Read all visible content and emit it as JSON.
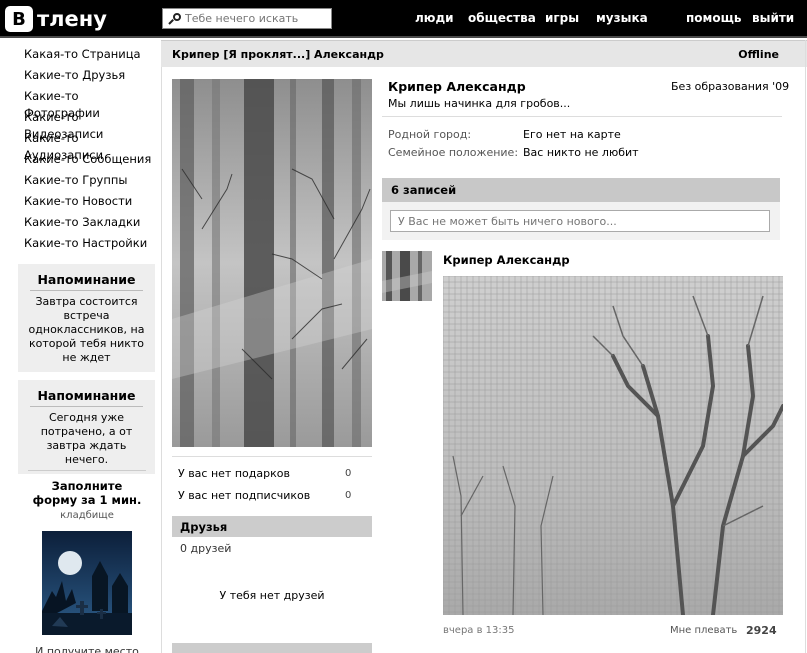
{
  "header": {
    "logo_letter": "В",
    "logo_text": "тлену",
    "search_placeholder": "Тебе нечего искать",
    "nav": [
      "люди",
      "общества",
      "игры",
      "музыка",
      "помощь",
      "выйти"
    ]
  },
  "sidebar": {
    "items": [
      "Какая-то Страница",
      "Какие-то Друзья",
      "Какие-то Фотографии",
      "Какие-то Видеозаписи",
      "Какие-то Аудиозаписи",
      "Какие-то Сообщения",
      "Какие-то Группы",
      "Какие-то Новости",
      "Какие-то Закладки",
      "Какие-то Настройки"
    ],
    "reminders": [
      {
        "title": "Напоминание",
        "text": "Завтра состоится встреча одноклассников, на которой тебя никто не ждет"
      },
      {
        "title": "Напоминание",
        "text": "Сегодня уже потрачено, а от завтра ждать нечего."
      }
    ],
    "promo": {
      "title": "Заполните форму за 1 мин.",
      "subtitle": "кладбище",
      "footer": "И получите место на"
    }
  },
  "profile": {
    "header_name": "Крипер [Я проклят...] Александр",
    "online_status": "Offline",
    "name": "Крипер Александр",
    "education": "Без образования '09",
    "status": "Мы лишь начинка для гробов...",
    "info": [
      {
        "label": "Родной город:",
        "value": "Его нет на карте"
      },
      {
        "label": "Семейное положение:",
        "value": "Вас никто не любит"
      }
    ],
    "stats": [
      {
        "label": "У вас нет подарков",
        "count": "0"
      },
      {
        "label": "У вас нет подписчиков",
        "count": "0"
      }
    ],
    "friends": {
      "title": "Друзья",
      "count": "0 друзей",
      "empty": "У тебя нет друзей"
    }
  },
  "wall": {
    "title": "6 записей",
    "input_placeholder": "У Вас не может быть ничего нового...",
    "post": {
      "author": "Крипер Александр",
      "time": "вчера в 13:35",
      "like_label": "Мне плевать",
      "likes": "2924"
    }
  }
}
